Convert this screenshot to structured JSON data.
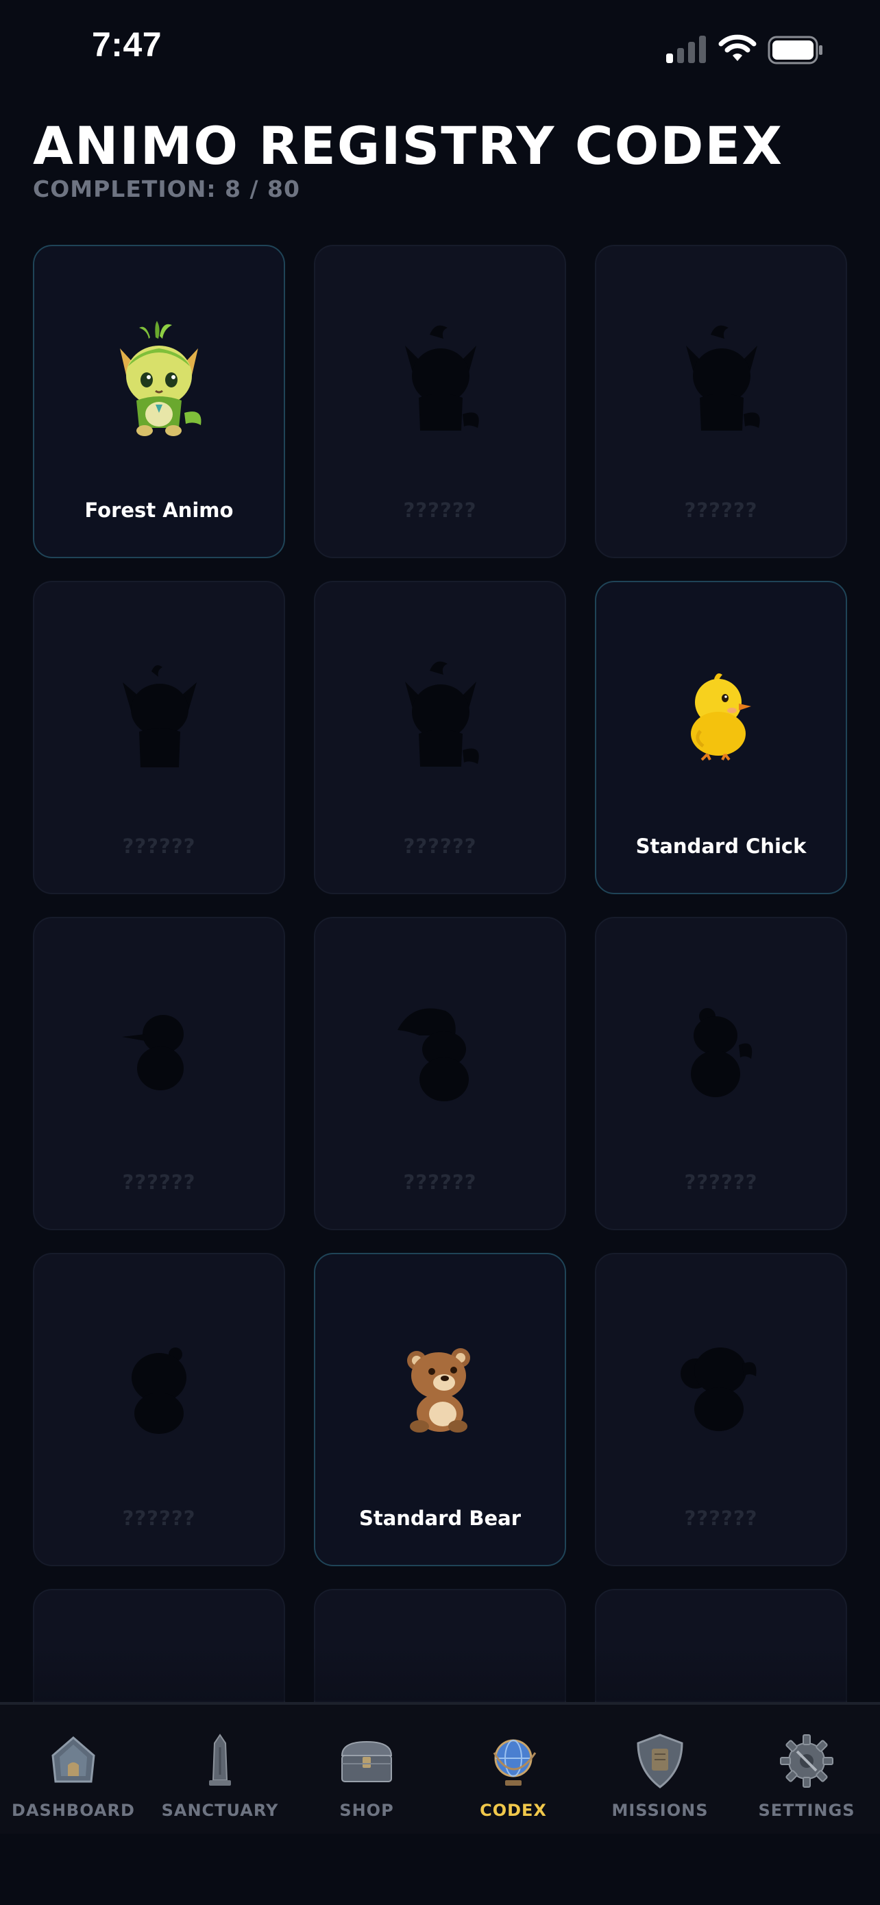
{
  "status_bar": {
    "time": "7:47",
    "icons": [
      "signal-icon",
      "wifi-icon",
      "battery-icon"
    ]
  },
  "header": {
    "title": "ANIMO REGISTRY CODEX",
    "completion": "COMPLETION: 8 / 80"
  },
  "colors": {
    "background": "#080b14",
    "card": "#0f1220",
    "discovered_border": "#1f4457",
    "locked_text": "#252a38",
    "active_tab": "#f1c84b",
    "inactive_tab": "#6e7482"
  },
  "cards": [
    {
      "name": "Forest Animo",
      "discovered": true,
      "art": "forest-animo"
    },
    {
      "name": "??????",
      "discovered": false,
      "art": "fox-silhouette"
    },
    {
      "name": "??????",
      "discovered": false,
      "art": "fox-silhouette"
    },
    {
      "name": "??????",
      "discovered": false,
      "art": "cat-silhouette"
    },
    {
      "name": "??????",
      "discovered": false,
      "art": "fox-silhouette"
    },
    {
      "name": "Standard Chick",
      "discovered": true,
      "art": "standard-chick"
    },
    {
      "name": "??????",
      "discovered": false,
      "art": "duck-silhouette"
    },
    {
      "name": "??????",
      "discovered": false,
      "art": "gnome-silhouette"
    },
    {
      "name": "??????",
      "discovered": false,
      "art": "squirrel-silhouette"
    },
    {
      "name": "??????",
      "discovered": false,
      "art": "round-silhouette"
    },
    {
      "name": "Standard Bear",
      "discovered": true,
      "art": "standard-bear"
    },
    {
      "name": "??????",
      "discovered": false,
      "art": "elephant-silhouette"
    },
    {
      "name": "",
      "discovered": false,
      "art": ""
    },
    {
      "name": "",
      "discovered": false,
      "art": ""
    },
    {
      "name": "",
      "discovered": false,
      "art": ""
    }
  ],
  "tabs": [
    {
      "label": "DASHBOARD",
      "icon": "house-icon",
      "active": false
    },
    {
      "label": "SANCTUARY",
      "icon": "obelisk-icon",
      "active": false
    },
    {
      "label": "SHOP",
      "icon": "treasure-chest-icon",
      "active": false
    },
    {
      "label": "CODEX",
      "icon": "globe-icon",
      "active": true
    },
    {
      "label": "MISSIONS",
      "icon": "shield-scroll-icon",
      "active": false
    },
    {
      "label": "SETTINGS",
      "icon": "gear-icon",
      "active": false
    }
  ]
}
